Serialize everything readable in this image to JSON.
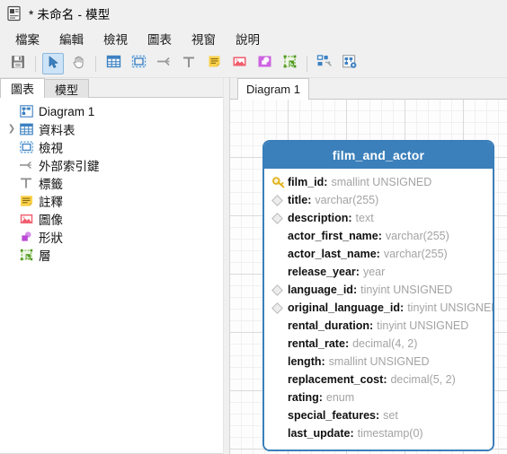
{
  "window": {
    "title": "* 未命名 - 模型",
    "icon": "model-document-icon"
  },
  "menubar": {
    "items": [
      {
        "label": "檔案",
        "name": "menu-file"
      },
      {
        "label": "編輯",
        "name": "menu-edit"
      },
      {
        "label": "檢視",
        "name": "menu-view"
      },
      {
        "label": "圖表",
        "name": "menu-diagram"
      },
      {
        "label": "視窗",
        "name": "menu-window"
      },
      {
        "label": "說明",
        "name": "menu-help"
      }
    ]
  },
  "toolbar": {
    "buttons": [
      {
        "name": "save-button",
        "icon": "save-icon"
      },
      {
        "name": "select-tool-button",
        "icon": "cursor-arrow-icon",
        "active": true
      },
      {
        "name": "pan-tool-button",
        "icon": "hand-icon"
      },
      {
        "name": "new-table-button",
        "icon": "table-grid-icon"
      },
      {
        "name": "new-view-button",
        "icon": "view-dashed-icon"
      },
      {
        "name": "new-foreign-key-button",
        "icon": "foreign-key-icon"
      },
      {
        "name": "new-label-button",
        "icon": "text-label-icon"
      },
      {
        "name": "new-note-button",
        "icon": "note-icon"
      },
      {
        "name": "new-image-button",
        "icon": "image-icon"
      },
      {
        "name": "new-shape-button",
        "icon": "shape-icon"
      },
      {
        "name": "new-layer-button",
        "icon": "layer-icon"
      },
      {
        "name": "auto-arrange-button",
        "icon": "auto-arrange-icon"
      },
      {
        "name": "diagram-settings-button",
        "icon": "diagram-settings-icon"
      }
    ]
  },
  "sidebar": {
    "tabs": [
      {
        "label": "圖表",
        "name": "sidebar-tab-diagrams",
        "active": true
      },
      {
        "label": "模型",
        "name": "sidebar-tab-model",
        "active": false
      }
    ],
    "items": [
      {
        "label": "Diagram 1",
        "icon": "diagram-icon",
        "name": "sidebar-item-diagram-1",
        "expandable": false
      },
      {
        "label": "資料表",
        "icon": "table-grid-icon",
        "name": "sidebar-item-tables",
        "expandable": true
      },
      {
        "label": "檢視",
        "icon": "view-dashed-icon",
        "name": "sidebar-item-views",
        "expandable": false
      },
      {
        "label": "外部索引鍵",
        "icon": "foreign-key-icon",
        "name": "sidebar-item-foreign-keys",
        "expandable": false
      },
      {
        "label": "標籤",
        "icon": "text-label-icon",
        "name": "sidebar-item-labels",
        "expandable": false
      },
      {
        "label": "註釋",
        "icon": "note-icon",
        "name": "sidebar-item-notes",
        "expandable": false
      },
      {
        "label": "圖像",
        "icon": "image-icon",
        "name": "sidebar-item-images",
        "expandable": false
      },
      {
        "label": "形狀",
        "icon": "shape-icon",
        "name": "sidebar-item-shapes",
        "expandable": false
      },
      {
        "label": "層",
        "icon": "layer-icon",
        "name": "sidebar-item-layers",
        "expandable": false
      }
    ]
  },
  "document": {
    "tabs": [
      {
        "label": "Diagram 1",
        "name": "document-tab-diagram-1",
        "active": true
      }
    ]
  },
  "entity": {
    "name": "film_and_actor",
    "header_color": "#3b80bb",
    "border_color": "#3a7fba",
    "columns": [
      {
        "name": "film_id",
        "type": "smallint UNSIGNED",
        "marker": "primary-key"
      },
      {
        "name": "title",
        "type": "varchar(255)",
        "marker": "index"
      },
      {
        "name": "description",
        "type": "text",
        "marker": "index"
      },
      {
        "name": "actor_first_name",
        "type": "varchar(255)",
        "marker": "none"
      },
      {
        "name": "actor_last_name",
        "type": "varchar(255)",
        "marker": "none"
      },
      {
        "name": "release_year",
        "type": "year",
        "marker": "none"
      },
      {
        "name": "language_id",
        "type": "tinyint UNSIGNED",
        "marker": "index"
      },
      {
        "name": "original_language_id",
        "type": "tinyint UNSIGNED",
        "marker": "index"
      },
      {
        "name": "rental_duration",
        "type": "tinyint UNSIGNED",
        "marker": "none"
      },
      {
        "name": "rental_rate",
        "type": "decimal(4, 2)",
        "marker": "none"
      },
      {
        "name": "length",
        "type": "smallint UNSIGNED",
        "marker": "none"
      },
      {
        "name": "replacement_cost",
        "type": "decimal(5, 2)",
        "marker": "none"
      },
      {
        "name": "rating",
        "type": "enum",
        "marker": "none"
      },
      {
        "name": "special_features",
        "type": "set",
        "marker": "none"
      },
      {
        "name": "last_update",
        "type": "timestamp(0)",
        "marker": "none"
      }
    ]
  }
}
